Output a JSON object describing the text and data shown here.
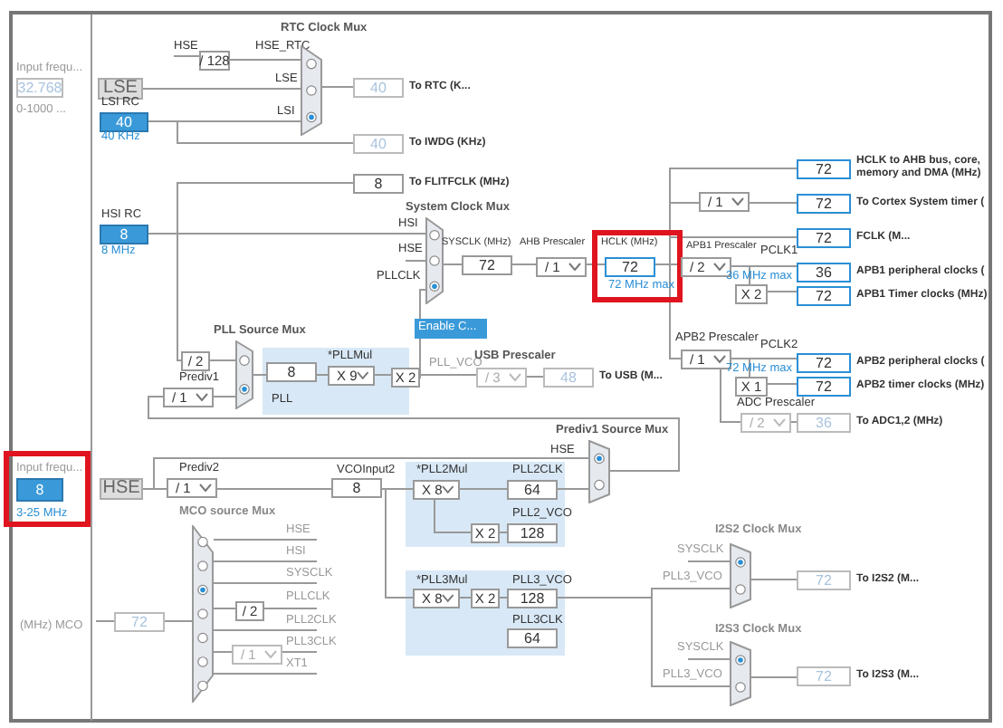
{
  "diagram": {
    "items": [
      {
        "kind": "dimlabel",
        "text": "Input frequ..."
      },
      {
        "kind": "field",
        "value": "32.768",
        "disabled": true,
        "highlighted": false
      },
      {
        "kind": "dimlabel",
        "text": "0-1000 ..."
      },
      {
        "kind": "source",
        "text": "LSE"
      },
      {
        "kind": "label",
        "text": "LSI RC"
      },
      {
        "kind": "input",
        "value": "40",
        "disabled": false
      },
      {
        "kind": "hint",
        "text": "40 KHz"
      },
      {
        "kind": "label",
        "text": "HSE"
      },
      {
        "kind": "factor",
        "text": "/ 128"
      },
      {
        "kind": "title",
        "text": "RTC Clock Mux"
      },
      {
        "kind": "label",
        "text": "HSE_RTC"
      },
      {
        "kind": "label",
        "text": "LSE"
      },
      {
        "kind": "label",
        "text": "LSI"
      },
      {
        "kind": "mux",
        "options": [
          {
            "selected": false
          },
          {
            "selected": false
          },
          {
            "selected": true
          }
        ]
      },
      {
        "kind": "field",
        "value": "40",
        "disabled": true,
        "highlighted": false
      },
      {
        "kind": "caption",
        "text": "To RTC (K..."
      },
      {
        "kind": "field",
        "value": "40",
        "disabled": true,
        "highlighted": false
      },
      {
        "kind": "caption",
        "text": "To IWDG (KHz)"
      },
      {
        "kind": "field",
        "value": "8",
        "disabled": false,
        "highlighted": false
      },
      {
        "kind": "caption",
        "text": "To FLITFCLK (MHz)"
      },
      {
        "kind": "label",
        "text": "HSI RC"
      },
      {
        "kind": "input",
        "value": "8",
        "disabled": false
      },
      {
        "kind": "hint",
        "text": "8 MHz"
      },
      {
        "kind": "title",
        "text": "System Clock Mux"
      },
      {
        "kind": "label",
        "text": "HSI"
      },
      {
        "kind": "label",
        "text": "HSE"
      },
      {
        "kind": "label",
        "text": "PLLCLK"
      },
      {
        "kind": "mux",
        "options": [
          {
            "selected": false
          },
          {
            "selected": false
          },
          {
            "selected": true
          }
        ]
      },
      {
        "kind": "label",
        "text": "SYSCLK (MHz)"
      },
      {
        "kind": "field",
        "value": "72",
        "disabled": false,
        "highlighted": false
      },
      {
        "kind": "label",
        "text": "AHB Prescaler"
      },
      {
        "kind": "dropdown",
        "value": "/ 1",
        "disabled": false
      },
      {
        "kind": "label",
        "text": "HCLK (MHz)"
      },
      {
        "kind": "output",
        "value": "72",
        "disabled": false,
        "highlighted": true
      },
      {
        "kind": "hint",
        "text": "72 MHz max"
      },
      {
        "kind": "button",
        "text": "Enable C..."
      },
      {
        "kind": "output",
        "value": "72",
        "disabled": false,
        "highlighted": false
      },
      {
        "kind": "caption",
        "text": "HCLK to AHB bus, core, memory and DMA (MHz)"
      },
      {
        "kind": "dropdown",
        "value": "/ 1",
        "disabled": false
      },
      {
        "kind": "output",
        "value": "72",
        "disabled": false,
        "highlighted": false
      },
      {
        "kind": "caption",
        "text": "To Cortex System timer ("
      },
      {
        "kind": "output",
        "value": "72",
        "disabled": false,
        "highlighted": false
      },
      {
        "kind": "caption",
        "text": "FCLK (M..."
      },
      {
        "kind": "label",
        "text": "APB1 Prescaler"
      },
      {
        "kind": "dropdown",
        "value": "/ 2",
        "disabled": false
      },
      {
        "kind": "label",
        "text": "PCLK1"
      },
      {
        "kind": "hint",
        "text": "36 MHz max"
      },
      {
        "kind": "output",
        "value": "36",
        "disabled": false,
        "highlighted": false
      },
      {
        "kind": "caption",
        "text": "APB1 peripheral clocks ("
      },
      {
        "kind": "factor",
        "text": "X 2"
      },
      {
        "kind": "output",
        "value": "72",
        "disabled": false,
        "highlighted": false
      },
      {
        "kind": "caption",
        "text": "APB1 Timer clocks (MHz)"
      },
      {
        "kind": "label",
        "text": "APB2 Prescaler"
      },
      {
        "kind": "dropdown",
        "value": "/ 1",
        "disabled": false
      },
      {
        "kind": "label",
        "text": "PCLK2"
      },
      {
        "kind": "hint",
        "text": "72 MHz max"
      },
      {
        "kind": "output",
        "value": "72",
        "disabled": false,
        "highlighted": false
      },
      {
        "kind": "caption",
        "text": "APB2 peripheral clocks ("
      },
      {
        "kind": "factor",
        "text": "X 1"
      },
      {
        "kind": "output",
        "value": "72",
        "disabled": false,
        "highlighted": false
      },
      {
        "kind": "caption",
        "text": "APB2 timer clocks (MHz)"
      },
      {
        "kind": "label",
        "text": "ADC Prescaler"
      },
      {
        "kind": "dropdown",
        "value": "/ 2",
        "disabled": true
      },
      {
        "kind": "field",
        "value": "36",
        "disabled": true,
        "highlighted": false
      },
      {
        "kind": "caption",
        "text": "To ADC1,2 (MHz)"
      },
      {
        "kind": "title",
        "text": "PLL Source Mux"
      },
      {
        "kind": "factor",
        "text": "/ 2"
      },
      {
        "kind": "label",
        "text": "Prediv1"
      },
      {
        "kind": "dropdown",
        "value": "/ 1",
        "disabled": false
      },
      {
        "kind": "mux",
        "options": [
          {
            "selected": false
          },
          {
            "selected": true
          }
        ]
      },
      {
        "kind": "field",
        "value": "8",
        "disabled": false,
        "highlighted": false
      },
      {
        "kind": "label",
        "text": "PLL"
      },
      {
        "kind": "label",
        "text": "*PLLMul"
      },
      {
        "kind": "dropdown",
        "value": "X 9",
        "disabled": false
      },
      {
        "kind": "factor",
        "text": "X 2"
      },
      {
        "kind": "dimlabel",
        "text": "PLL_VCO"
      },
      {
        "kind": "title",
        "text": "USB Prescaler"
      },
      {
        "kind": "dropdown",
        "value": "/ 3",
        "disabled": true
      },
      {
        "kind": "field",
        "value": "48",
        "disabled": true,
        "highlighted": false
      },
      {
        "kind": "caption",
        "text": "To USB (M..."
      },
      {
        "kind": "dimlabel",
        "text": "Input frequ..."
      },
      {
        "kind": "input",
        "value": "8",
        "disabled": false,
        "highlighted": true
      },
      {
        "kind": "hint",
        "text": "3-25 MHz"
      },
      {
        "kind": "source",
        "text": "HSE"
      },
      {
        "kind": "label",
        "text": "Prediv2"
      },
      {
        "kind": "dropdown",
        "value": "/ 1",
        "disabled": false
      },
      {
        "kind": "label",
        "text": "VCOInput2"
      },
      {
        "kind": "field",
        "value": "8",
        "disabled": false,
        "highlighted": false
      },
      {
        "kind": "label",
        "text": "*PLL2Mul"
      },
      {
        "kind": "dropdown",
        "value": "X 8",
        "disabled": false
      },
      {
        "kind": "label",
        "text": "PLL2CLK"
      },
      {
        "kind": "field",
        "value": "64",
        "disabled": false,
        "highlighted": false
      },
      {
        "kind": "label",
        "text": "PLL2_VCO"
      },
      {
        "kind": "factor",
        "text": "X 2"
      },
      {
        "kind": "field",
        "value": "128",
        "disabled": false,
        "highlighted": false
      },
      {
        "kind": "title",
        "text": "Prediv1 Source Mux"
      },
      {
        "kind": "label",
        "text": "HSE"
      },
      {
        "kind": "mux",
        "options": [
          {
            "selected": true
          },
          {
            "selected": false
          }
        ]
      },
      {
        "kind": "label",
        "text": "*PLL3Mul"
      },
      {
        "kind": "dropdown",
        "value": "X 8",
        "disabled": false
      },
      {
        "kind": "factor",
        "text": "X 2"
      },
      {
        "kind": "label",
        "text": "PLL3_VCO"
      },
      {
        "kind": "field",
        "value": "128",
        "disabled": false,
        "highlighted": false
      },
      {
        "kind": "label",
        "text": "PLL3CLK"
      },
      {
        "kind": "field",
        "value": "64",
        "disabled": false,
        "highlighted": false
      },
      {
        "kind": "dimtitle",
        "text": "MCO source Mux"
      },
      {
        "kind": "dimlabel",
        "text": "HSE"
      },
      {
        "kind": "dimlabel",
        "text": "HSI"
      },
      {
        "kind": "dimlabel",
        "text": "SYSCLK"
      },
      {
        "kind": "dimlabel",
        "text": "PLLCLK"
      },
      {
        "kind": "dimlabel",
        "text": "PLL2CLK"
      },
      {
        "kind": "dimlabel",
        "text": "PLL3CLK"
      },
      {
        "kind": "dimlabel",
        "text": "XT1"
      },
      {
        "kind": "factor",
        "text": "/ 2"
      },
      {
        "kind": "dropdown",
        "value": "/ 1",
        "disabled": true
      },
      {
        "kind": "mux",
        "options": [
          {
            "selected": false
          },
          {
            "selected": false
          },
          {
            "selected": true
          },
          {
            "selected": false
          },
          {
            "selected": false
          },
          {
            "selected": false
          },
          {
            "selected": false
          }
        ]
      },
      {
        "kind": "dimlabel",
        "text": "(MHz) MCO"
      },
      {
        "kind": "field",
        "value": "72",
        "disabled": true,
        "highlighted": false
      },
      {
        "kind": "dimtitle",
        "text": "I2S2 Clock Mux"
      },
      {
        "kind": "dimlabel",
        "text": "SYSCLK"
      },
      {
        "kind": "dimlabel",
        "text": "PLL3_VCO"
      },
      {
        "kind": "mux",
        "options": [
          {
            "selected": true
          },
          {
            "selected": false
          }
        ]
      },
      {
        "kind": "field",
        "value": "72",
        "disabled": true,
        "highlighted": false
      },
      {
        "kind": "caption",
        "text": "To I2S2 (M..."
      },
      {
        "kind": "dimtitle",
        "text": "I2S3 Clock Mux"
      },
      {
        "kind": "dimlabel",
        "text": "SYSCLK"
      },
      {
        "kind": "dimlabel",
        "text": "PLL3_VCO"
      },
      {
        "kind": "mux",
        "options": [
          {
            "selected": true
          },
          {
            "selected": false
          }
        ]
      },
      {
        "kind": "field",
        "value": "72",
        "disabled": true,
        "highlighted": false
      },
      {
        "kind": "caption",
        "text": "To I2S3 (M..."
      }
    ]
  }
}
